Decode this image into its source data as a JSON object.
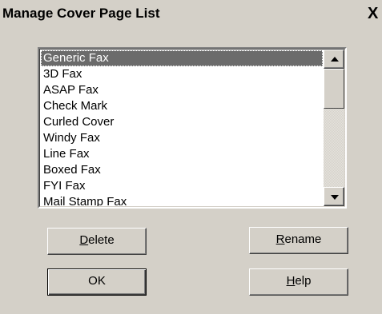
{
  "window": {
    "title": "Manage Cover Page List",
    "close_glyph": "X"
  },
  "cover_pages": {
    "selected_index": 0,
    "items": [
      "Generic Fax",
      "3D Fax",
      "ASAP Fax",
      "Check Mark",
      "Curled Cover",
      "Windy Fax",
      "Line Fax",
      "Boxed Fax",
      "FYI Fax",
      "Mail Stamp Fax"
    ]
  },
  "buttons": {
    "delete": {
      "accel": "D",
      "rest": "elete"
    },
    "rename": {
      "accel": "R",
      "rest": "ename"
    },
    "ok": {
      "label": "OK"
    },
    "help": {
      "accel": "H",
      "rest": "elp"
    }
  },
  "icons": {
    "scroll_up": "up-arrow-icon",
    "scroll_down": "down-arrow-icon",
    "close": "close-icon"
  }
}
